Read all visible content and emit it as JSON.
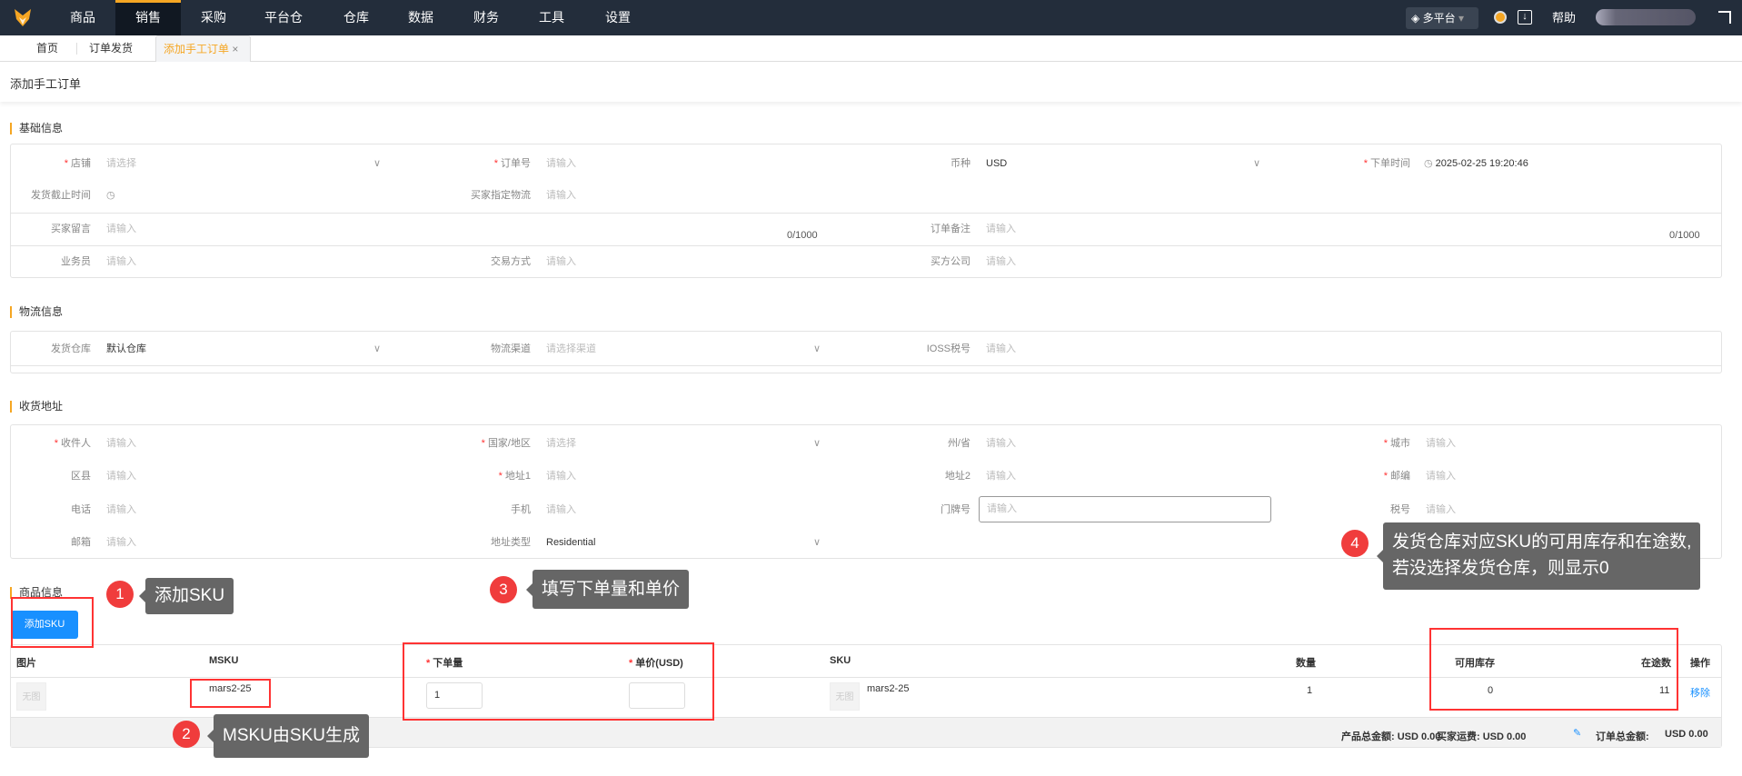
{
  "nav": {
    "items": [
      "商品",
      "销售",
      "采购",
      "平台仓",
      "仓库",
      "数据",
      "财务",
      "工具",
      "设置"
    ],
    "active": "销售",
    "platform": "多平台",
    "help": "帮助"
  },
  "tabs": [
    "首页",
    "订单发货",
    "添加手工订单"
  ],
  "page_title": "添加手工订单",
  "basic": {
    "title": "基础信息",
    "shop": {
      "label": "店铺",
      "placeholder": "请选择"
    },
    "order_no": {
      "label": "订单号",
      "placeholder": "请输入"
    },
    "currency": {
      "label": "币种",
      "value": "USD"
    },
    "order_time": {
      "label": "下单时间",
      "value": "2025-02-25 19:20:46"
    },
    "ship_deadline": {
      "label": "发货截止时间"
    },
    "buyer_logistics": {
      "label": "买家指定物流",
      "placeholder": "请输入"
    },
    "buyer_msg": {
      "label": "买家留言",
      "placeholder": "请输入",
      "count": "0/1000"
    },
    "order_note": {
      "label": "订单备注",
      "placeholder": "请输入",
      "count": "0/1000"
    },
    "salesman": {
      "label": "业务员",
      "placeholder": "请输入"
    },
    "trade_method": {
      "label": "交易方式",
      "placeholder": "请输入"
    },
    "buyer_company": {
      "label": "买方公司",
      "placeholder": "请输入"
    }
  },
  "logistics": {
    "title": "物流信息",
    "warehouse": {
      "label": "发货仓库",
      "value": "默认仓库"
    },
    "channel": {
      "label": "物流渠道",
      "placeholder": "请选择渠道"
    },
    "ioss": {
      "label": "IOSS税号",
      "placeholder": "请输入"
    }
  },
  "address": {
    "title": "收货地址",
    "receiver": {
      "label": "收件人",
      "placeholder": "请输入"
    },
    "country": {
      "label": "国家/地区",
      "placeholder": "请选择"
    },
    "state": {
      "label": "州/省",
      "placeholder": "请输入"
    },
    "city": {
      "label": "城市",
      "placeholder": "请输入"
    },
    "district": {
      "label": "区县",
      "placeholder": "请输入"
    },
    "addr1": {
      "label": "地址1",
      "placeholder": "请输入"
    },
    "addr2": {
      "label": "地址2",
      "placeholder": "请输入"
    },
    "zip": {
      "label": "邮编",
      "placeholder": "请输入"
    },
    "phone": {
      "label": "电话",
      "placeholder": "请输入"
    },
    "mobile": {
      "label": "手机",
      "placeholder": "请输入"
    },
    "house_no": {
      "label": "门牌号",
      "placeholder": "请输入"
    },
    "tax_no": {
      "label": "税号",
      "placeholder": "请输入"
    },
    "email": {
      "label": "邮箱",
      "placeholder": "请输入"
    },
    "addr_type": {
      "label": "地址类型",
      "value": "Residential"
    }
  },
  "products": {
    "title": "商品信息",
    "add_button": "添加SKU",
    "columns": {
      "image": "图片",
      "msku": "MSKU",
      "qty": "下单量",
      "price": "单价(USD)",
      "sku": "SKU",
      "quantity": "数量",
      "available": "可用库存",
      "in_transit": "在途数",
      "action": "操作"
    },
    "rows": [
      {
        "image": "无图",
        "msku": "mars2-25",
        "qty": "1",
        "price": "",
        "sku_image": "无图",
        "sku": "mars2-25",
        "quantity": "1",
        "available": "0",
        "in_transit": "11",
        "action": "移除"
      }
    ],
    "footer": {
      "product_total": "产品总金额: USD 0.00",
      "shipping": "买家运费: USD 0.00",
      "order_total_label": "订单总金额:",
      "order_total": "USD 0.00"
    }
  },
  "annotations": [
    {
      "num": "1",
      "text": "添加SKU"
    },
    {
      "num": "2",
      "text": "MSKU由SKU生成"
    },
    {
      "num": "3",
      "text": "填写下单量和单价"
    },
    {
      "num": "4",
      "line1": "发货仓库对应SKU的可用库存和在途数,",
      "line2": "若没选择发货仓库，则显示0"
    }
  ],
  "colors": {
    "nav": "#232d3b",
    "accent": "#f5a623",
    "primary": "#1890ff",
    "annotation": "#f03c3c"
  }
}
